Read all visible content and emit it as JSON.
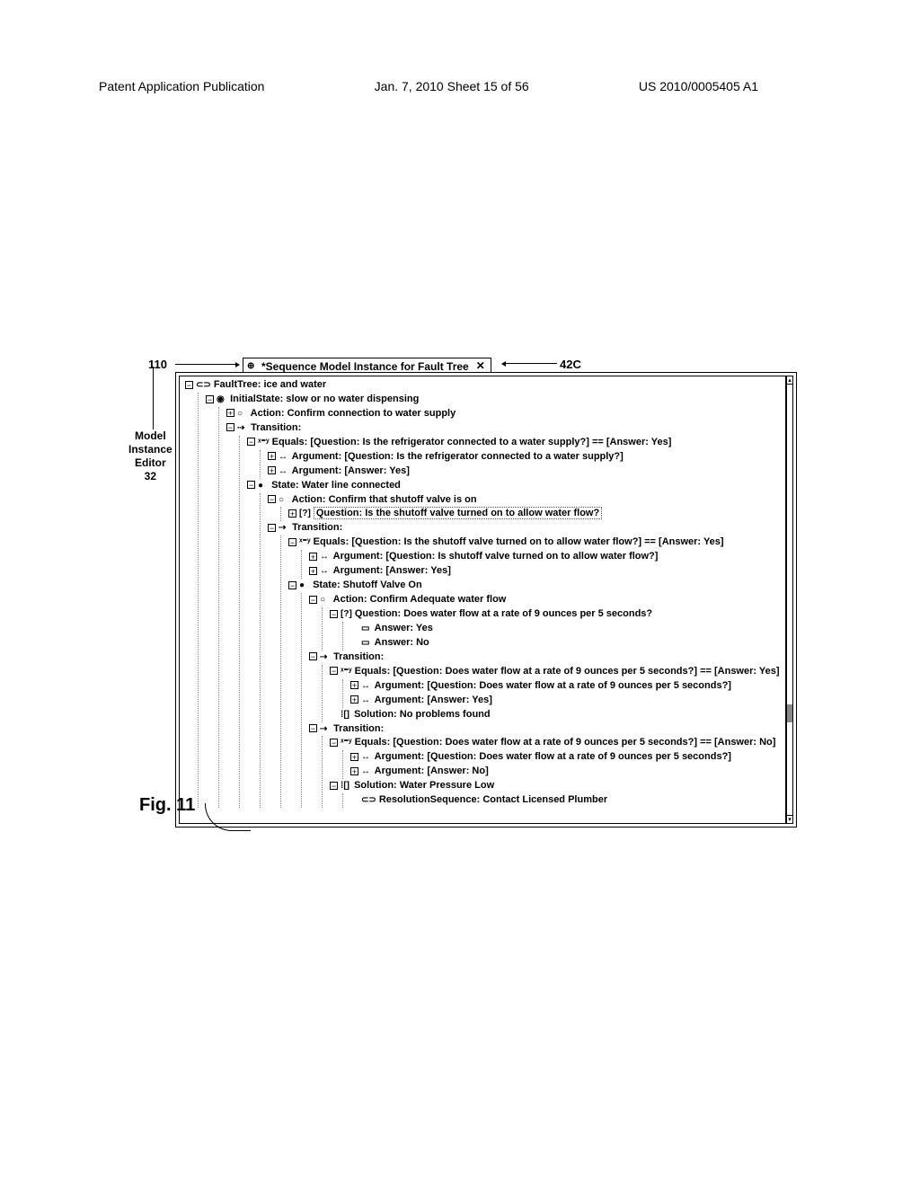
{
  "header": {
    "left": "Patent Application Publication",
    "center": "Jan. 7, 2010  Sheet 15 of 56",
    "right": "US 2010/0005405 A1"
  },
  "callouts": {
    "c110": "110",
    "c42c": "42C",
    "model_editor_line1": "Model",
    "model_editor_line2": "Instance",
    "model_editor_line3": "Editor",
    "model_editor_line4": "32"
  },
  "tab": {
    "title": "*Sequence Model Instance for Fault Tree",
    "close": "✕"
  },
  "fig": "Fig. 11",
  "tree": {
    "root": "FaultTree: ice and water",
    "initialState": "InitialState: slow or no water dispensing",
    "action1": "Action: Confirm connection to water supply",
    "transition1": "Transition:",
    "t1_equals": "Equals: [Question: Is the refrigerator connected to a water supply?] == [Answer: Yes]",
    "t1_arg1": "Argument: [Question: Is the refrigerator connected to a water supply?]",
    "t1_arg2": "Argument: [Answer: Yes]",
    "state1": "State: Water line connected",
    "action2": "Action: Confirm that shutoff valve is on",
    "question2": "Question: Is the shutoff valve turned on to allow water flow?",
    "transition2": "Transition:",
    "t2_equals": "Equals: [Question: Is the shutoff valve turned on to allow water flow?] == [Answer: Yes]",
    "t2_arg1": "Argument: [Question: Is shutoff valve turned on to allow water flow?]",
    "t2_arg2": "Argument: [Answer: Yes]",
    "state2": "State: Shutoff Valve On",
    "action3": "Action: Confirm Adequate water flow",
    "question3": "Question: Does water flow at a rate of 9 ounces per 5 seconds?",
    "ans_yes": "Answer: Yes",
    "ans_no": "Answer: No",
    "transition3": "Transition:",
    "t3_equals": "Equals: [Question: Does water flow at a rate of 9 ounces per 5 seconds?] == [Answer: Yes]",
    "t3_arg1": "Argument: [Question: Does water flow at a rate of 9 ounces per 5 seconds?]",
    "t3_arg2": "Argument: [Answer: Yes]",
    "solution1": "Solution: No problems found",
    "transition4": "Transition:",
    "t4_equals": "Equals: [Question: Does water flow at a rate of 9 ounces per 5 seconds?] == [Answer: No]",
    "t4_arg1": "Argument: [Question: Does water flow at a rate of 9 ounces per 5 seconds?]",
    "t4_arg2": "Argument: [Answer: No]",
    "solution2": "Solution: Water Pressure Low",
    "resolution": "ResolutionSequence: Contact Licensed Plumber"
  },
  "icons": {
    "faulttree": "⊂⊃",
    "initialstate": "◉",
    "action": "○",
    "transition": "⇢",
    "equals": "ˣ⁼ʸ",
    "argument": "↔",
    "state": "●",
    "question": "[?]",
    "answer": "▭",
    "solution": "⁞[]",
    "resolution": "⊂⊃"
  }
}
